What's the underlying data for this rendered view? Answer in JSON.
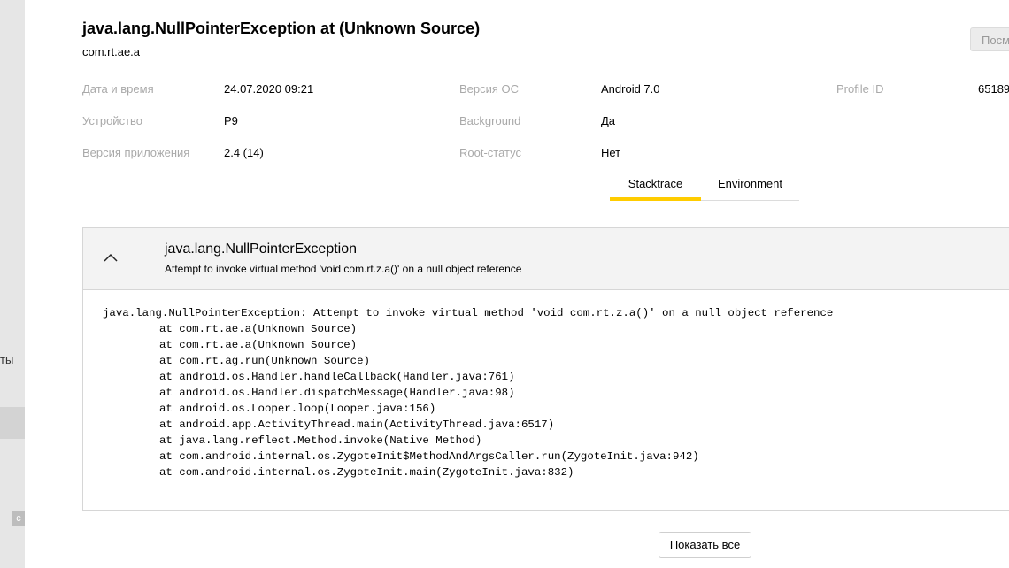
{
  "sidebar": {
    "partial_text": "ты",
    "badge_text": "с"
  },
  "header": {
    "title": "java.lang.NullPointerException at (Unknown Source)",
    "subtitle": "com.rt.ae.a",
    "top_button_label": "Посм"
  },
  "info": {
    "datetime_label": "Дата и время",
    "datetime_value": "24.07.2020 09:21",
    "os_label": "Версия ОС",
    "os_value": "Android 7.0",
    "profile_label": "Profile ID",
    "profile_value": "65189",
    "device_label": "Устройство",
    "device_value": "P9",
    "background_label": "Background",
    "background_value": "Да",
    "app_version_label": "Версия приложения",
    "app_version_value": "2.4 (14)",
    "root_label": "Root-статус",
    "root_value": "Нет"
  },
  "tabs": {
    "stacktrace": "Stacktrace",
    "environment": "Environment",
    "active": "Stacktrace",
    "accent_color": "#ffcc00"
  },
  "exception": {
    "name": "java.lang.NullPointerException",
    "message": "Attempt to invoke virtual method 'void com.rt.z.a()' on a null object reference",
    "toggle_icon": "chevron-up-icon",
    "stack_lines": [
      "java.lang.NullPointerException: Attempt to invoke virtual method 'void com.rt.z.a()' on a null object reference",
      "at com.rt.ae.a(Unknown Source)",
      "at com.rt.ae.a(Unknown Source)",
      "at com.rt.ag.run(Unknown Source)",
      "at android.os.Handler.handleCallback(Handler.java:761)",
      "at android.os.Handler.dispatchMessage(Handler.java:98)",
      "at android.os.Looper.loop(Looper.java:156)",
      "at android.app.ActivityThread.main(ActivityThread.java:6517)",
      "at java.lang.reflect.Method.invoke(Native Method)",
      "at com.android.internal.os.ZygoteInit$MethodAndArgsCaller.run(ZygoteInit.java:942)",
      "at com.android.internal.os.ZygoteInit.main(ZygoteInit.java:832)"
    ]
  },
  "footer": {
    "show_all_label": "Показать все"
  }
}
